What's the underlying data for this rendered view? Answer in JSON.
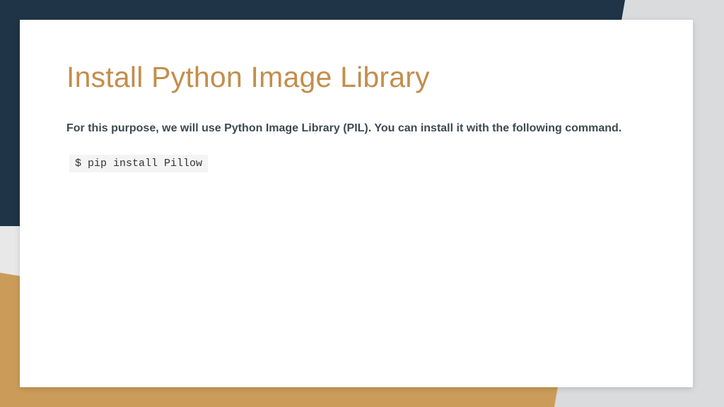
{
  "slide": {
    "title": "Install Python Image Library",
    "body": "For this purpose, we will use Python Image Library (PIL). You can install it with the following command.",
    "code": "$ pip install Pillow"
  }
}
